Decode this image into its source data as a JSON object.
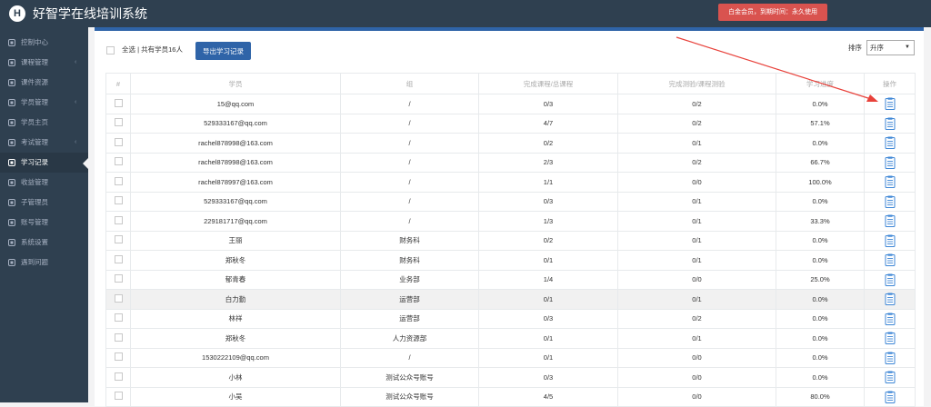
{
  "header": {
    "logo_letter": "H",
    "title": "好智学在线培训系统",
    "member_badge": "白金会员，到期时间：永久使用"
  },
  "sidebar": {
    "items": [
      {
        "label": "控制中心",
        "icon": "dashboard-icon",
        "has_arrow": false,
        "active": false
      },
      {
        "label": "课程管理",
        "icon": "course-icon",
        "has_arrow": true,
        "active": false
      },
      {
        "label": "课件资源",
        "icon": "courseware-icon",
        "has_arrow": false,
        "active": false
      },
      {
        "label": "学员管理",
        "icon": "users-icon",
        "has_arrow": true,
        "active": false
      },
      {
        "label": "学员主页",
        "icon": "user-home-icon",
        "has_arrow": false,
        "active": false
      },
      {
        "label": "考试管理",
        "icon": "exam-icon",
        "has_arrow": true,
        "active": false
      },
      {
        "label": "学习记录",
        "icon": "book-icon",
        "has_arrow": false,
        "active": true
      },
      {
        "label": "收益管理",
        "icon": "revenue-icon",
        "has_arrow": false,
        "active": false
      },
      {
        "label": "子管理员",
        "icon": "sub-admin-icon",
        "has_arrow": false,
        "active": false
      },
      {
        "label": "账号管理",
        "icon": "account-icon",
        "has_arrow": false,
        "active": false
      },
      {
        "label": "系统设置",
        "icon": "gear-icon",
        "has_arrow": false,
        "active": false
      },
      {
        "label": "遇到问题",
        "icon": "help-icon",
        "has_arrow": false,
        "active": false
      }
    ]
  },
  "toolbar": {
    "select_all_text": "全选 | 共有学员16人",
    "export_label": "导出学习记录",
    "sort_label": "排序",
    "sort_value": "升序"
  },
  "table": {
    "headers": [
      "#",
      "学员",
      "组",
      "完成课程/总课程",
      "完成测验/课程测验",
      "学习进度",
      "操作"
    ],
    "rows": [
      {
        "student": "15@qq.com",
        "group": "/",
        "courses": "0/3",
        "quizzes": "0/2",
        "progress": "0.0%"
      },
      {
        "student": "529333167@qq.com",
        "group": "/",
        "courses": "4/7",
        "quizzes": "0/2",
        "progress": "57.1%"
      },
      {
        "student": "rachel878998@163.com",
        "group": "/",
        "courses": "0/2",
        "quizzes": "0/1",
        "progress": "0.0%"
      },
      {
        "student": "rachel878998@163.com",
        "group": "/",
        "courses": "2/3",
        "quizzes": "0/2",
        "progress": "66.7%"
      },
      {
        "student": "rachel878997@163.com",
        "group": "/",
        "courses": "1/1",
        "quizzes": "0/0",
        "progress": "100.0%"
      },
      {
        "student": "529333167@qq.com",
        "group": "/",
        "courses": "0/3",
        "quizzes": "0/1",
        "progress": "0.0%"
      },
      {
        "student": "229181717@qq.com",
        "group": "/",
        "courses": "1/3",
        "quizzes": "0/1",
        "progress": "33.3%"
      },
      {
        "student": "王丽",
        "group": "财务科",
        "courses": "0/2",
        "quizzes": "0/1",
        "progress": "0.0%"
      },
      {
        "student": "郑秋冬",
        "group": "财务科",
        "courses": "0/1",
        "quizzes": "0/1",
        "progress": "0.0%"
      },
      {
        "student": "郁青春",
        "group": "业务部",
        "courses": "1/4",
        "quizzes": "0/0",
        "progress": "25.0%"
      },
      {
        "student": "白力勤",
        "group": "运营部",
        "courses": "0/1",
        "quizzes": "0/1",
        "progress": "0.0%"
      },
      {
        "student": "林祥",
        "group": "运营部",
        "courses": "0/3",
        "quizzes": "0/2",
        "progress": "0.0%"
      },
      {
        "student": "郑秋冬",
        "group": "人力资源部",
        "courses": "0/1",
        "quizzes": "0/1",
        "progress": "0.0%"
      },
      {
        "student": "1530222109@qq.com",
        "group": "/",
        "courses": "0/1",
        "quizzes": "0/0",
        "progress": "0.0%"
      },
      {
        "student": "小林",
        "group": "测试公众号账号",
        "courses": "0/3",
        "quizzes": "0/0",
        "progress": "0.0%"
      },
      {
        "student": "小吴",
        "group": "测试公众号账号",
        "courses": "4/5",
        "quizzes": "0/0",
        "progress": "80.0%"
      }
    ],
    "highlighted_row": 10
  },
  "colors": {
    "nav_bg": "#2f4050",
    "accent": "#2f64a8",
    "badge": "#d9534f",
    "annotation": "#e8413a"
  }
}
